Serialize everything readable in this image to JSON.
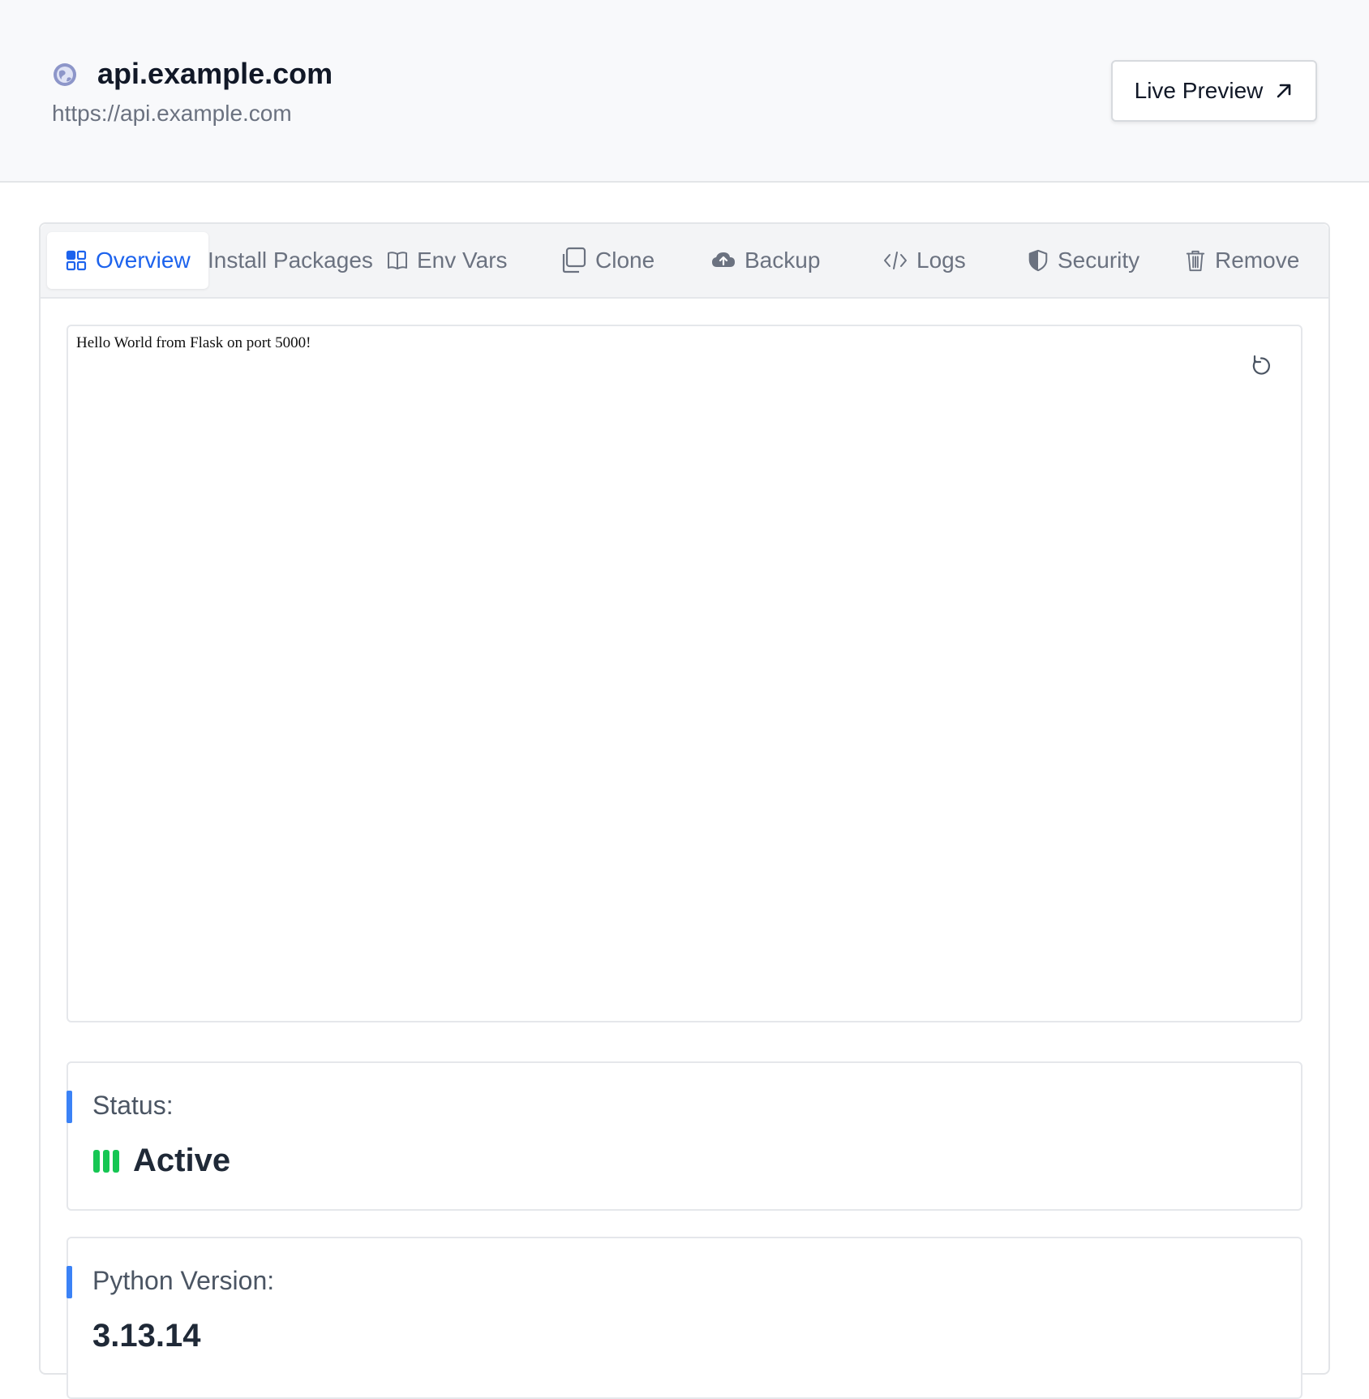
{
  "header": {
    "title": "api.example.com",
    "url": "https://api.example.com",
    "live_preview_label": "Live Preview"
  },
  "tabs": [
    {
      "label": "Overview",
      "icon": "grid-icon",
      "active": true
    },
    {
      "label": "Install Packages",
      "icon": "",
      "active": false
    },
    {
      "label": "Env Vars",
      "icon": "book-icon",
      "active": false
    },
    {
      "label": "Clone",
      "icon": "copy-icon",
      "active": false
    },
    {
      "label": "Backup",
      "icon": "cloud-upload-icon",
      "active": false
    },
    {
      "label": "Logs",
      "icon": "code-icon",
      "active": false
    },
    {
      "label": "Security",
      "icon": "shield-icon",
      "active": false
    },
    {
      "label": "Remove",
      "icon": "trash-icon",
      "active": false
    }
  ],
  "preview": {
    "content": "Hello World from Flask on port 5000!"
  },
  "status": {
    "label": "Status:",
    "value": "Active",
    "color": "#16c653"
  },
  "python": {
    "label": "Python Version:",
    "value": "3.13.14"
  },
  "colors": {
    "accent": "#1d63ed",
    "bar": "#3b82f6"
  }
}
